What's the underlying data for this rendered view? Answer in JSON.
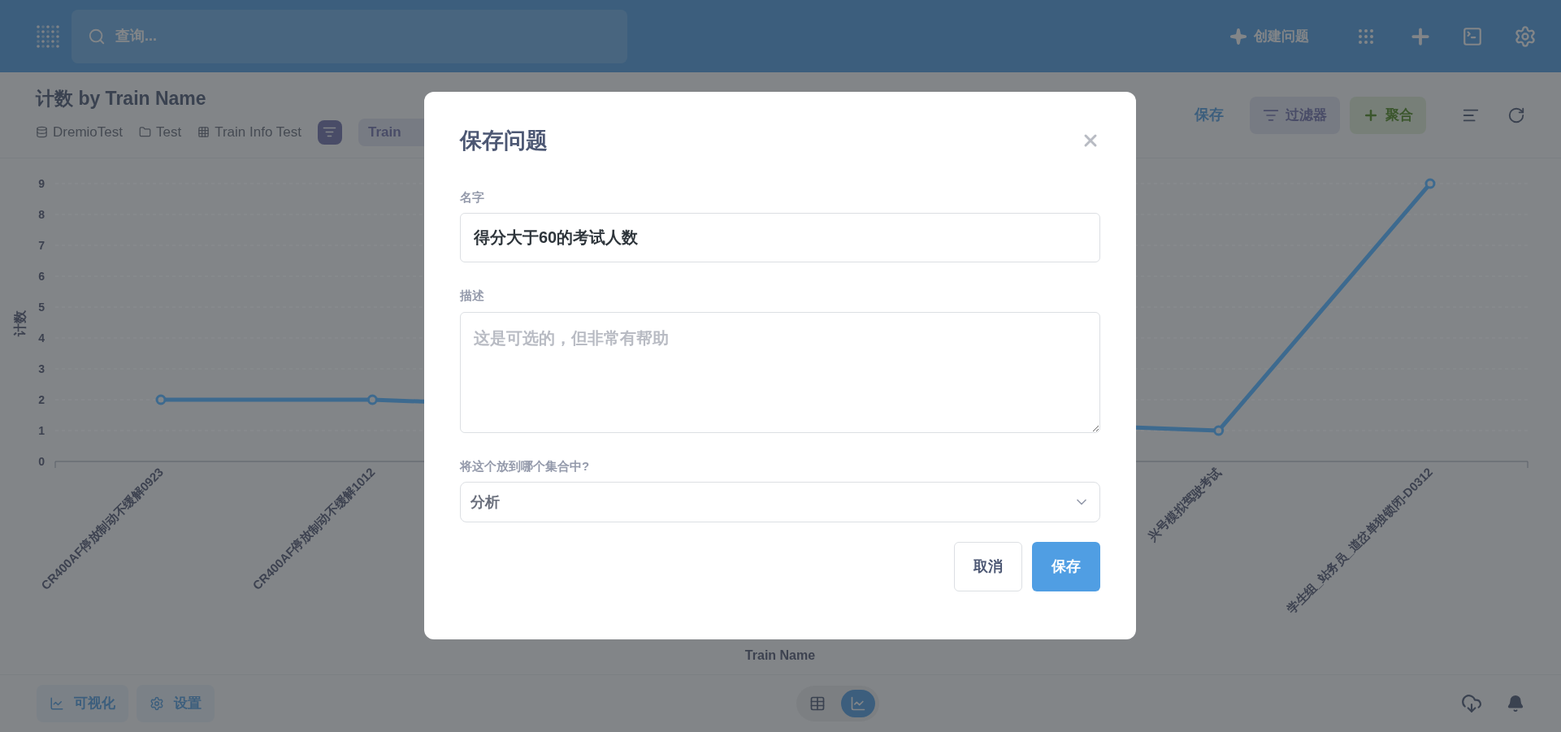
{
  "top_bar": {
    "search": {
      "placeholder": "查询..."
    },
    "new_question": "创建问题"
  },
  "question_header": {
    "title": "计数 by Train Name",
    "breadcrumbs": [
      {
        "kind": "database",
        "label": "DremioTest"
      },
      {
        "kind": "folder",
        "label": "Test"
      },
      {
        "kind": "table",
        "label": "Train Info Test"
      }
    ],
    "filter_chip": "Train",
    "actions": {
      "save": "保存",
      "filter": "过滤器",
      "summarize": "聚合"
    }
  },
  "chart": {
    "chart_data": {
      "type": "line",
      "xlabel": "Train Name",
      "ylabel": "计数",
      "categories": [
        "CR400AF停放制动不缓解0923",
        "CR400AF停放制动不缓解1012",
        null,
        null,
        null,
        "兴号模拟驾驶考试",
        "学生组_站务员_道岔单独锁闭-D0312"
      ],
      "series": [
        {
          "color": "#3d6a8f",
          "marker": true,
          "values": [
            2,
            2,
            null,
            null,
            null,
            1,
            9
          ]
        }
      ],
      "ylim": [
        0,
        9
      ],
      "yticks": [
        0,
        1,
        2,
        3,
        4,
        5,
        6,
        7,
        8,
        9
      ]
    }
  },
  "footer": {
    "visualization": "可视化",
    "settings": "设置",
    "view_toggle": [
      {
        "kind": "table",
        "selected": false
      },
      {
        "kind": "chart",
        "selected": true
      }
    ]
  },
  "dialog": {
    "title": "保存问题",
    "name_label": "名字",
    "name_value": "得分大于60的考试人数",
    "description_label": "描述",
    "description_placeholder": "这是可选的，但非常有帮助",
    "collection_label": "将这个放到哪个集合中?",
    "collection_value": "分析",
    "buttons": [
      {
        "kind": "secondary",
        "label": "取消"
      },
      {
        "kind": "primary",
        "label": "保存"
      }
    ]
  }
}
